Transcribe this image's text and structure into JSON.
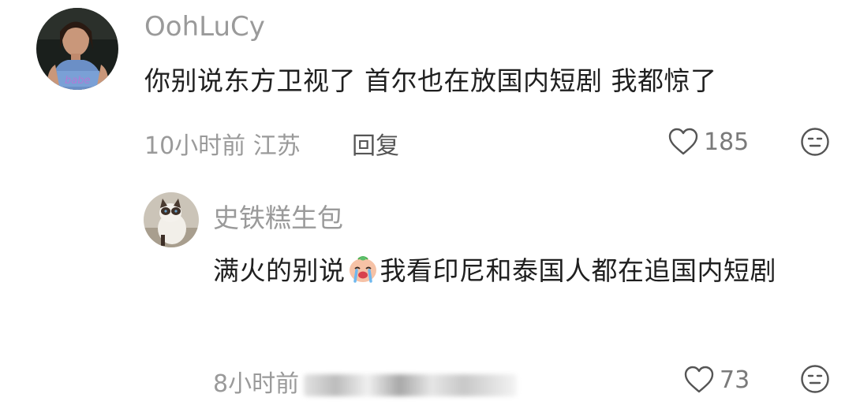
{
  "comments": [
    {
      "username": "OohLuCy",
      "text": "你别说东方卫视了 首尔也在放国内短剧 我都惊了",
      "time": "10小时前",
      "location": "江苏",
      "reply_label": "回复",
      "likes": "185",
      "avatar_icon": "user-avatar-woman",
      "like_icon": "heart-outline-icon",
      "face_icon": "neutral-face-icon"
    },
    {
      "username": "史铁糕生包",
      "text_before_emoji": "满火的别说",
      "emoji": "crying-face-emoji",
      "text_after_emoji": "我看印尼和泰国人都在追国内短剧",
      "time": "8小时前",
      "likes": "73",
      "avatar_icon": "user-avatar-cat",
      "like_icon": "heart-outline-icon",
      "face_icon": "neutral-face-icon"
    }
  ],
  "colors": {
    "meta_text": "#9a9a9a",
    "body_text": "#1f1f1f",
    "icon_stroke": "#555555"
  }
}
